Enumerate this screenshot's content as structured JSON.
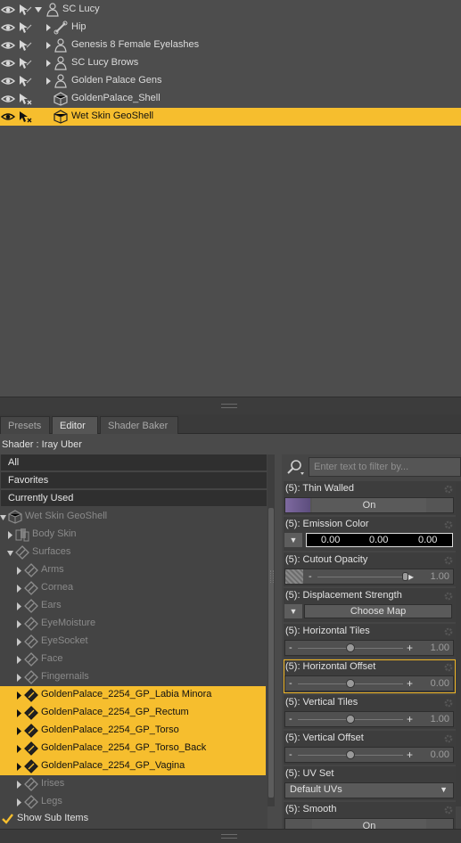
{
  "scene": {
    "rows": [
      {
        "label": "SC Lucy",
        "icon": "figure-icon",
        "expanded": true,
        "indent": 0
      },
      {
        "label": "Hip",
        "icon": "bone-icon",
        "indent": 1
      },
      {
        "label": "Genesis 8 Female Eyelashes",
        "icon": "figure-icon",
        "indent": 1
      },
      {
        "label": "SC Lucy Brows",
        "icon": "figure-icon",
        "indent": 1
      },
      {
        "label": "Golden Palace Gens",
        "icon": "figure-icon",
        "indent": 1
      },
      {
        "label": "GoldenPalace_Shell",
        "icon": "geoshell-icon",
        "indent": 1
      },
      {
        "label": "Wet Skin GeoShell",
        "icon": "geoshell-icon",
        "indent": 1,
        "selected": true
      }
    ]
  },
  "tabs": [
    "Presets",
    "Editor",
    "Shader Baker"
  ],
  "active_tab": "Editor",
  "shader_line": "Shader : Iray Uber",
  "filters": [
    "All",
    "Favorites",
    "Currently Used"
  ],
  "tree": [
    {
      "label": "Wet Skin GeoShell",
      "level": 0,
      "expanded": true
    },
    {
      "label": "Body Skin",
      "level": 1
    },
    {
      "label": "Surfaces",
      "level": 1,
      "expanded": true
    },
    {
      "label": "Arms",
      "level": 2
    },
    {
      "label": "Cornea",
      "level": 2
    },
    {
      "label": "Ears",
      "level": 2
    },
    {
      "label": "EyeMoisture",
      "level": 2
    },
    {
      "label": "EyeSocket",
      "level": 2
    },
    {
      "label": "Face",
      "level": 2
    },
    {
      "label": "Fingernails",
      "level": 2
    },
    {
      "label": "GoldenPalace_2254_GP_Labia Minora",
      "level": 2,
      "selected": true
    },
    {
      "label": "GoldenPalace_2254_GP_Rectum",
      "level": 2,
      "selected": true
    },
    {
      "label": "GoldenPalace_2254_GP_Torso",
      "level": 2,
      "selected": true
    },
    {
      "label": "GoldenPalace_2254_GP_Torso_Back",
      "level": 2,
      "selected": true
    },
    {
      "label": "GoldenPalace_2254_GP_Vagina",
      "level": 2,
      "selected": true
    },
    {
      "label": "Irises",
      "level": 2
    },
    {
      "label": "Legs",
      "level": 2
    }
  ],
  "show_sub_items": "Show Sub Items",
  "search_placeholder": "Enter text to filter by...",
  "properties": {
    "thin_walled": {
      "label": "(5): Thin Walled",
      "value": "On"
    },
    "emission_color": {
      "label": "(5): Emission Color",
      "r": "0.00",
      "g": "0.00",
      "b": "0.00"
    },
    "cutout_opacity": {
      "label": "(5): Cutout Opacity",
      "value": "1.00",
      "level": 1.0
    },
    "displacement_strength": {
      "label": "(5): Displacement Strength",
      "button": "Choose Map"
    },
    "horizontal_tiles": {
      "label": "(5): Horizontal Tiles",
      "value": "1.00",
      "level": 0.5
    },
    "horizontal_offset": {
      "label": "(5): Horizontal Offset",
      "value": "0.00",
      "level": 0.5
    },
    "vertical_tiles": {
      "label": "(5): Vertical Tiles",
      "value": "1.00",
      "level": 0.5
    },
    "vertical_offset": {
      "label": "(5): Vertical Offset",
      "value": "0.00",
      "level": 0.5
    },
    "uv_set": {
      "label": "(5): UV Set",
      "value": "Default UVs"
    },
    "smooth": {
      "label": "(5): Smooth",
      "value": "On"
    }
  },
  "colors": {
    "selection": "#f6be2e",
    "panel": "#4d4d4d",
    "highlight_border": "#f0b625"
  }
}
